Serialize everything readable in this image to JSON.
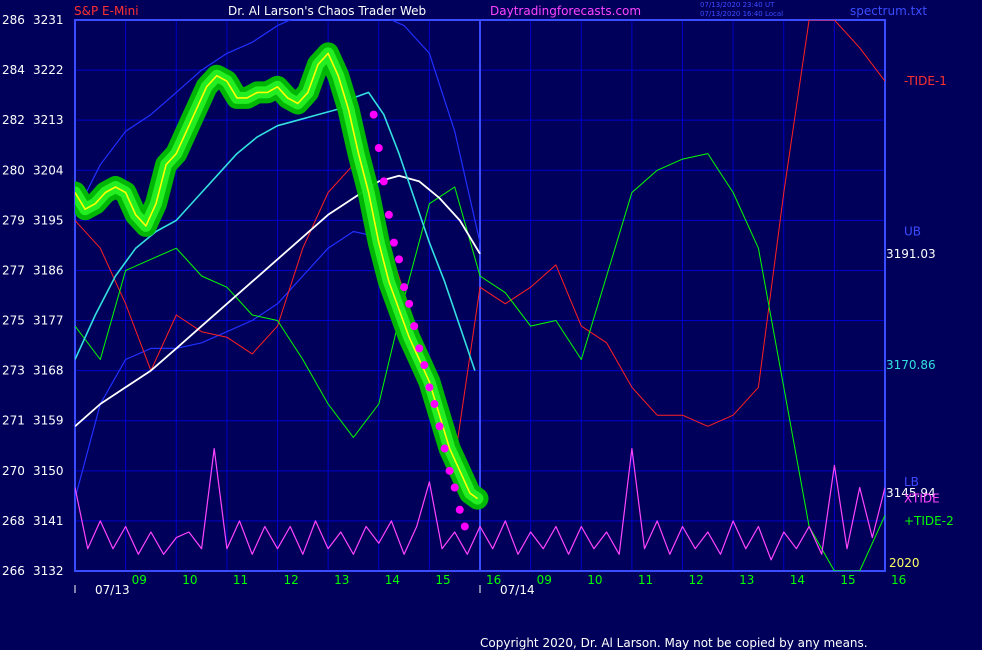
{
  "chart_data": {
    "type": "line",
    "title": "S&P E-Mini",
    "subtitle": "Dr. Al Larson's Chaos Trader Web",
    "site": "Daytradingforecasts.com",
    "timestamp_utc": "07/13/2020 23:40 UT",
    "timestamp_local": "07/13/2020 16:40 Local",
    "file_label": "spectrum.txt",
    "copyright": "Copyright 2020, Dr. Al Larson. May not be copied by any means.",
    "colors": {
      "background": "#00005a",
      "plot_border": "#3a4cff",
      "grid": "#0000cc",
      "left_axis_text": "#ffffff",
      "title": "#ff3030",
      "subtitle": "#ffffff",
      "site": "#ff44ff",
      "time_labels": "#00ff00",
      "date_labels": "#ffffff",
      "copyright": "#ffffff"
    },
    "y_axis": {
      "ylim": [
        3132,
        3231
      ],
      "labels": [
        {
          "left": "286",
          "right": "3231"
        },
        {
          "left": "284",
          "right": "3222"
        },
        {
          "left": "282",
          "right": "3213"
        },
        {
          "left": "280",
          "right": "3204"
        },
        {
          "left": "279",
          "right": "3195"
        },
        {
          "left": "277",
          "right": "3186"
        },
        {
          "left": "275",
          "right": "3177"
        },
        {
          "left": "273",
          "right": "3168"
        },
        {
          "left": "271",
          "right": "3159"
        },
        {
          "left": "270",
          "right": "3150"
        },
        {
          "left": "268",
          "right": "3141"
        },
        {
          "left": "266",
          "right": "3132"
        }
      ]
    },
    "x_axis": {
      "xlim": [
        8,
        24
      ],
      "ticks": [
        {
          "x": 9,
          "label": "09"
        },
        {
          "x": 10,
          "label": "10"
        },
        {
          "x": 11,
          "label": "11"
        },
        {
          "x": 12,
          "label": "12"
        },
        {
          "x": 13,
          "label": "13"
        },
        {
          "x": 14,
          "label": "14"
        },
        {
          "x": 15,
          "label": "15"
        },
        {
          "x": 16,
          "label": "16"
        },
        {
          "x": 17,
          "label": "09"
        },
        {
          "x": 18,
          "label": "10"
        },
        {
          "x": 19,
          "label": "11"
        },
        {
          "x": 20,
          "label": "12"
        },
        {
          "x": 21,
          "label": "13"
        },
        {
          "x": 22,
          "label": "14"
        },
        {
          "x": 23,
          "label": "15"
        },
        {
          "x": 24,
          "label": "16"
        }
      ],
      "dates": [
        {
          "x": 8.5,
          "label": "07/13"
        },
        {
          "x": 16.5,
          "label": "07/14"
        }
      ],
      "year": {
        "x": 24.5,
        "label": "2020"
      }
    },
    "right_labels": [
      {
        "text": "-TIDE-1",
        "value": 3220,
        "color": "#ff3030",
        "offset": 18
      },
      {
        "text": "UB",
        "value": 3193,
        "color": "#3a4cff",
        "offset": 18
      },
      {
        "text": "3191.03",
        "value": 3189,
        "color": "#ffffff",
        "offset": 0
      },
      {
        "text": "3170.86",
        "value": 3169,
        "color": "#33e0e0",
        "offset": 0
      },
      {
        "text": "LB",
        "value": 3148,
        "color": "#3a4cff",
        "offset": 18
      },
      {
        "text": "3145.94",
        "value": 3146,
        "color": "#ffffff",
        "offset": 0
      },
      {
        "text": "XTIDE",
        "value": 3145,
        "color": "#ff44ff",
        "offset": 18
      },
      {
        "text": "+TIDE-2",
        "value": 3141,
        "color": "#00ff00",
        "offset": 18
      }
    ],
    "series": [
      {
        "key": "price",
        "color": "#ffff00",
        "glow": "#00c000",
        "width": 1.6,
        "x": [
          8.0,
          8.2,
          8.4,
          8.6,
          8.8,
          9.0,
          9.2,
          9.4,
          9.6,
          9.8,
          10.0,
          10.2,
          10.4,
          10.6,
          10.8,
          11.0,
          11.2,
          11.4,
          11.6,
          11.8,
          12.0,
          12.2,
          12.4,
          12.6,
          12.8,
          13.0,
          13.2,
          13.4,
          13.6,
          13.8,
          14.0,
          14.2,
          14.4,
          14.6,
          14.8,
          15.0,
          15.2,
          15.4,
          15.6,
          15.8,
          15.95
        ],
        "values": [
          3200,
          3197,
          3198,
          3200,
          3201,
          3200,
          3196,
          3194,
          3198,
          3205,
          3207,
          3211,
          3215,
          3219,
          3221,
          3220,
          3217,
          3217,
          3218,
          3218,
          3219,
          3217,
          3216,
          3218,
          3223,
          3225,
          3221,
          3215,
          3207,
          3200,
          3191,
          3184,
          3179,
          3174,
          3170,
          3166,
          3160,
          3154,
          3150,
          3146,
          3145
        ]
      },
      {
        "key": "cycle-fast",
        "color": "#ff44ff",
        "width": 1.2,
        "x": [
          8.0,
          8.25,
          8.5,
          8.75,
          9.0,
          9.25,
          9.5,
          9.75,
          10.0,
          10.25,
          10.5,
          10.75,
          11.0,
          11.25,
          11.5,
          11.75,
          12.0,
          12.25,
          12.5,
          12.75,
          13.0,
          13.25,
          13.5,
          13.75,
          14.0,
          14.25,
          14.5,
          14.75,
          15.0,
          15.25,
          15.5,
          15.75,
          16.0,
          16.25,
          16.5,
          16.75,
          17.0,
          17.25,
          17.5,
          17.75,
          18.0,
          18.25,
          18.5,
          18.75,
          19.0,
          19.25,
          19.5,
          19.75,
          20.0,
          20.25,
          20.5,
          20.75,
          21.0,
          21.25,
          21.5,
          21.75,
          22.0,
          22.25,
          22.5,
          22.75,
          23.0,
          23.25,
          23.5,
          23.75,
          24.0
        ],
        "values": [
          3147,
          3136,
          3141,
          3136,
          3140,
          3135,
          3139,
          3135,
          3138,
          3139,
          3136,
          3154,
          3136,
          3141,
          3135,
          3140,
          3136,
          3140,
          3135,
          3141,
          3136,
          3139,
          3135,
          3140,
          3137,
          3141,
          3135,
          3140,
          3148,
          3136,
          3139,
          3135,
          3140,
          3136,
          3141,
          3135,
          3139,
          3136,
          3140,
          3135,
          3140,
          3136,
          3139,
          3135,
          3154,
          3136,
          3141,
          3135,
          3140,
          3136,
          3139,
          3135,
          3141,
          3136,
          3140,
          3134,
          3139,
          3136,
          3140,
          3135,
          3151,
          3136,
          3147,
          3138,
          3147
        ]
      },
      {
        "key": "moving-average-fast",
        "color": "#33e0e0",
        "width": 1.6,
        "x": [
          8.0,
          8.4,
          8.8,
          9.2,
          9.6,
          10.0,
          10.4,
          10.8,
          11.2,
          11.6,
          12.0,
          12.4,
          12.8,
          13.2,
          13.5,
          13.8,
          14.1,
          14.4,
          14.7,
          15.0,
          15.3,
          15.6,
          15.9
        ],
        "values": [
          3170,
          3178,
          3185,
          3190,
          3193,
          3195,
          3199,
          3203,
          3207,
          3210,
          3212,
          3213,
          3214,
          3215,
          3217,
          3218,
          3214,
          3207,
          3199,
          3191,
          3184,
          3176,
          3168
        ]
      },
      {
        "key": "moving-average-slow",
        "color": "#ffffff",
        "width": 1.8,
        "x": [
          8.0,
          8.5,
          9.0,
          9.5,
          10.0,
          10.5,
          11.0,
          11.5,
          12.0,
          12.5,
          13.0,
          13.5,
          14.0,
          14.4,
          14.8,
          15.2,
          15.6,
          16.0
        ],
        "values": [
          3158,
          3162,
          3165,
          3168,
          3172,
          3176,
          3180,
          3184,
          3188,
          3192,
          3196,
          3199,
          3202,
          3203,
          3202,
          3199,
          3195,
          3189
        ]
      },
      {
        "key": "upper-band",
        "color": "#2030ff",
        "width": 1.2,
        "x": [
          8.0,
          8.5,
          9.0,
          9.5,
          10.0,
          10.5,
          11.0,
          11.5,
          12.0,
          12.5,
          13.0,
          13.5,
          14.0,
          14.5,
          15.0,
          15.5,
          16.0
        ],
        "values": [
          3196,
          3205,
          3211,
          3214,
          3218,
          3222,
          3225,
          3227,
          3230,
          3232,
          3232,
          3232,
          3232,
          3230,
          3225,
          3211,
          3191
        ]
      },
      {
        "key": "lower-band",
        "color": "#2030ff",
        "width": 1.2,
        "x": [
          8.0,
          8.5,
          9.0,
          9.5,
          10.0,
          10.5,
          11.0,
          11.5,
          12.0,
          12.5,
          13.0,
          13.5,
          14.0,
          14.5,
          15.0,
          15.5,
          16.0
        ],
        "values": [
          3145,
          3162,
          3170,
          3172,
          3172,
          3173,
          3175,
          3177,
          3180,
          3185,
          3190,
          3193,
          3192,
          3180,
          3165,
          3152,
          3146
        ]
      },
      {
        "key": "tide-1",
        "color": "#ff2020",
        "width": 1.0,
        "x": [
          8.0,
          8.5,
          9.0,
          9.5,
          10.0,
          10.5,
          11.0,
          11.5,
          12.0,
          12.5,
          13.0,
          13.5,
          14.0,
          14.5,
          15.0,
          15.5,
          16.0,
          16.5,
          17.0,
          17.5,
          18.0,
          18.5,
          19.0,
          19.5,
          20.0,
          20.5,
          21.0,
          21.5,
          22.0,
          22.5,
          23.0,
          23.5,
          24.0
        ],
        "values": [
          3195,
          3190,
          3180,
          3168,
          3178,
          3175,
          3174,
          3171,
          3176,
          3190,
          3200,
          3205,
          3196,
          3182,
          3168,
          3152,
          3183,
          3180,
          3183,
          3187,
          3176,
          3173,
          3165,
          3160,
          3160,
          3158,
          3160,
          3165,
          3200,
          3231,
          3231,
          3226,
          3220
        ]
      },
      {
        "key": "tide-2",
        "color": "#00ff00",
        "width": 1.0,
        "x": [
          8.0,
          8.5,
          9.0,
          9.5,
          10.0,
          10.5,
          11.0,
          11.5,
          12.0,
          12.5,
          13.0,
          13.5,
          14.0,
          14.5,
          15.0,
          15.5,
          16.0,
          16.5,
          17.0,
          17.5,
          18.0,
          18.5,
          19.0,
          19.5,
          20.0,
          20.5,
          21.0,
          21.5,
          22.0,
          22.5,
          23.0,
          23.5,
          24.0
        ],
        "values": [
          3176,
          3170,
          3186,
          3188,
          3190,
          3185,
          3183,
          3178,
          3177,
          3170,
          3162,
          3156,
          3162,
          3181,
          3198,
          3201,
          3185,
          3182,
          3176,
          3177,
          3170,
          3185,
          3200,
          3204,
          3206,
          3207,
          3200,
          3190,
          3165,
          3140,
          3132,
          3132,
          3142
        ]
      }
    ],
    "markers": {
      "color": "#ff00ff",
      "x": [
        13.9,
        14.0,
        14.1,
        14.2,
        14.3,
        14.4,
        14.5,
        14.6,
        14.7,
        14.8,
        14.9,
        15.0,
        15.1,
        15.2,
        15.3,
        15.4,
        15.5,
        15.6,
        15.7
      ],
      "values": [
        3214,
        3208,
        3202,
        3196,
        3191,
        3188,
        3183,
        3180,
        3176,
        3172,
        3169,
        3165,
        3162,
        3158,
        3154,
        3150,
        3147,
        3143,
        3140
      ]
    }
  }
}
